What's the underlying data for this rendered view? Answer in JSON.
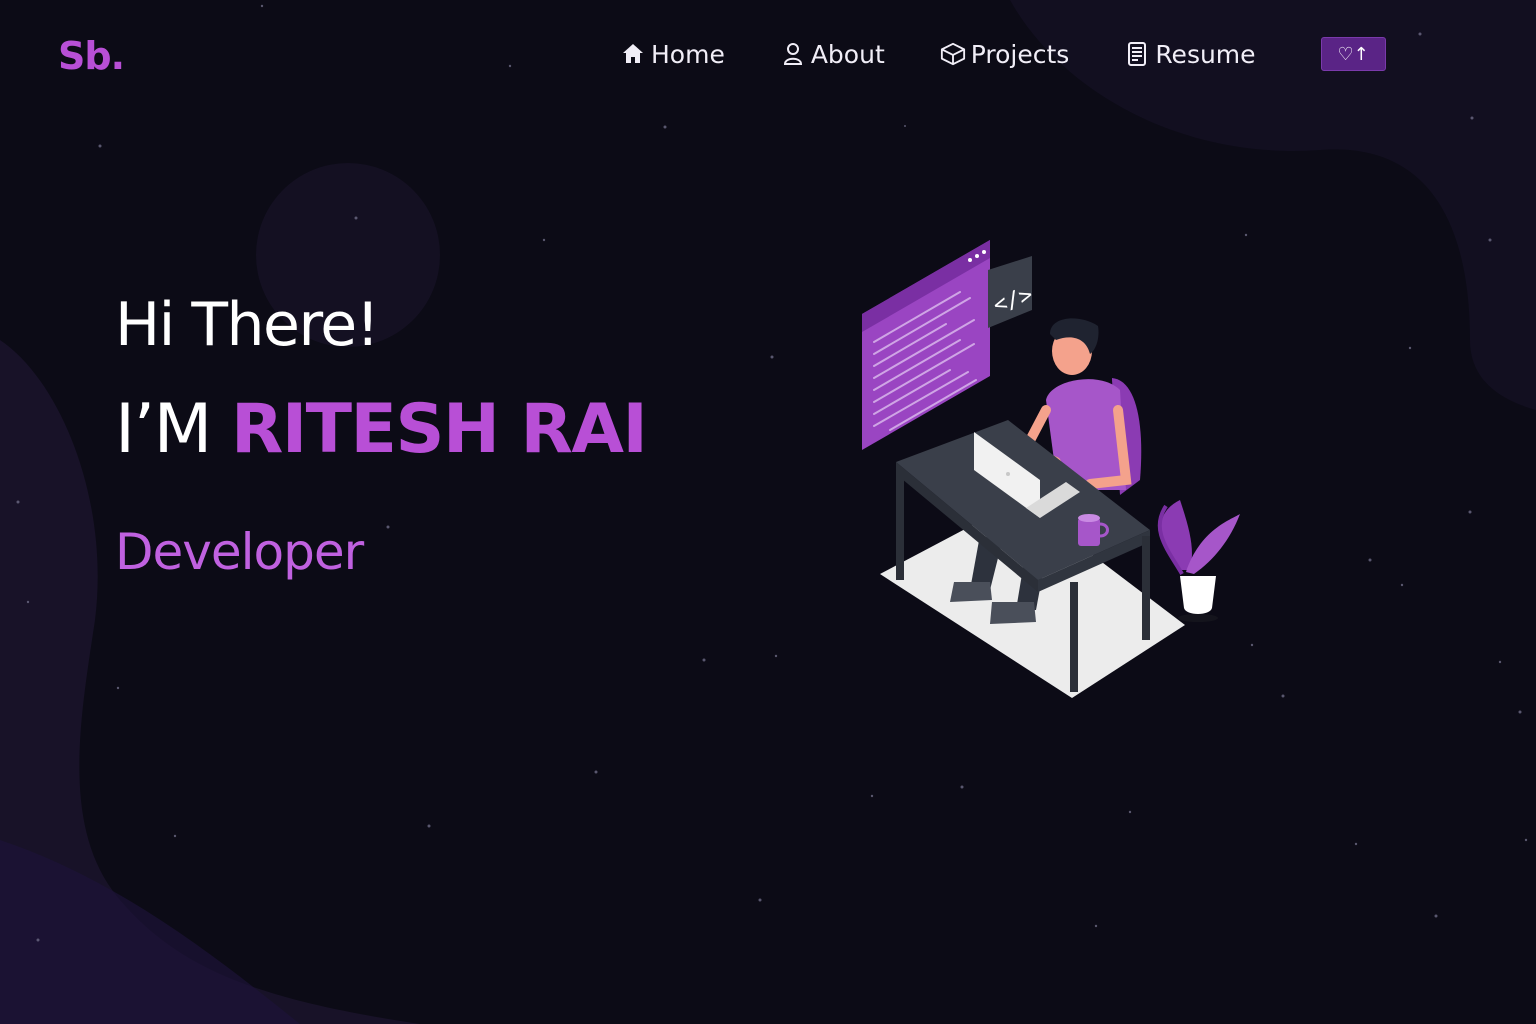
{
  "logo": {
    "text": "Sb."
  },
  "nav": {
    "items": [
      {
        "label": "Home",
        "icon": "home-icon"
      },
      {
        "label": "About",
        "icon": "user-icon"
      },
      {
        "label": "Projects",
        "icon": "box-icon"
      },
      {
        "label": "Resume",
        "icon": "document-icon"
      }
    ],
    "github_button": {
      "label": "♡↑",
      "icon": "fork-star-icon"
    }
  },
  "hero": {
    "greeting": "Hi There!",
    "intro_prefix": "I’M ",
    "name": "RITESH RAI",
    "role": "Developer"
  },
  "illustration": {
    "code_tag": "</>"
  },
  "colors": {
    "background": "#0c0b16",
    "accent": "#b84fd6",
    "button": "#5a2486"
  }
}
